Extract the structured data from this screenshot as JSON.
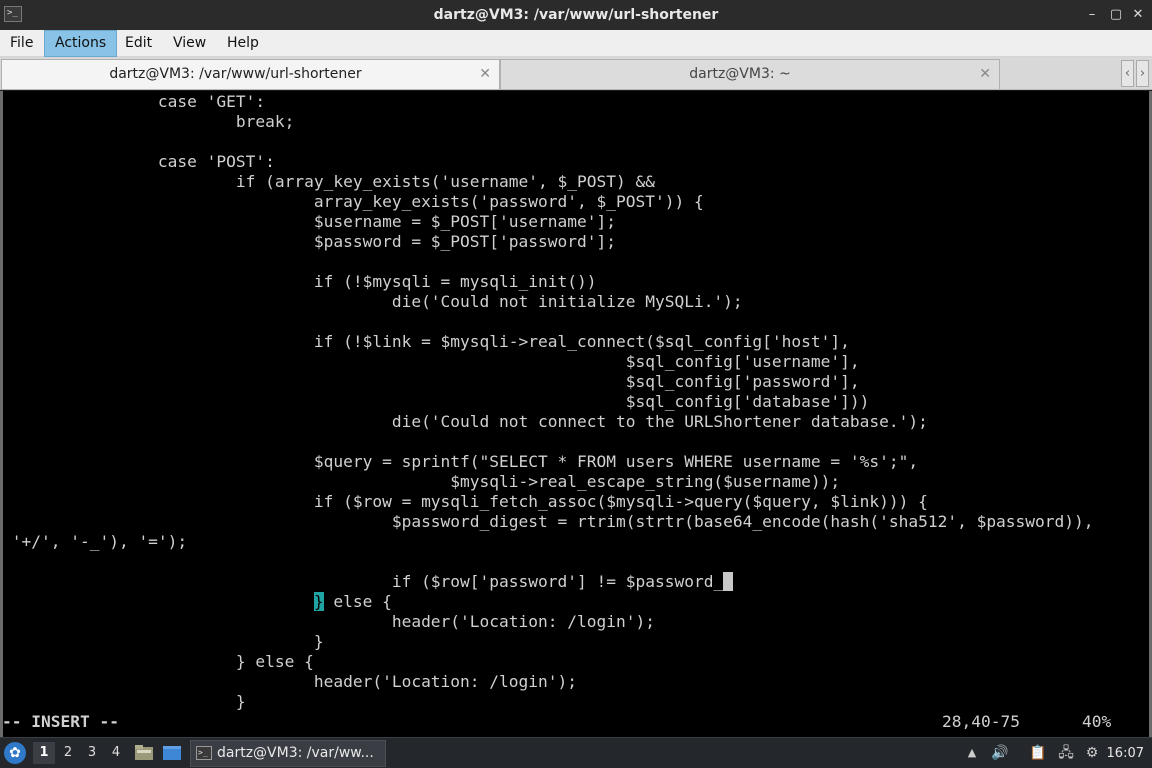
{
  "window": {
    "title": "dartz@VM3: /var/www/url-shortener",
    "app_icon_glyph": ">_",
    "minimize_glyph": "–",
    "maximize_glyph": "▢",
    "close_glyph": "✕"
  },
  "menu": {
    "items": [
      "File",
      "Actions",
      "Edit",
      "View",
      "Help"
    ],
    "active": "Actions"
  },
  "tabs": [
    {
      "label": "dartz@VM3: /var/www/url-shortener",
      "close": "✕",
      "active": true
    },
    {
      "label": "dartz@VM3: ~",
      "close": "✕",
      "active": false
    }
  ],
  "tab_scroll": {
    "left": "‹",
    "right": "›"
  },
  "terminal": {
    "lines": [
      {
        "text": "                case 'GET':"
      },
      {
        "text": "                        break;"
      },
      {
        "text": ""
      },
      {
        "text": "                case 'POST':"
      },
      {
        "text": "                        if (array_key_exists('username', $_POST) &&"
      },
      {
        "text": "                                array_key_exists('password', $_POST')) {"
      },
      {
        "text": "                                $username = $_POST['username'];"
      },
      {
        "text": "                                $password = $_POST['password'];"
      },
      {
        "text": ""
      },
      {
        "text": "                                if (!$mysqli = mysqli_init())"
      },
      {
        "text": "                                        die('Could not initialize MySQLi.');"
      },
      {
        "text": ""
      },
      {
        "text": "                                if (!$link = $mysqli->real_connect($sql_config['host'],"
      },
      {
        "text": "                                                                $sql_config['username'],"
      },
      {
        "text": "                                                                $sql_config['password'],"
      },
      {
        "text": "                                                                $sql_config['database']))"
      },
      {
        "text": "                                        die('Could not connect to the URLShortener database.');"
      },
      {
        "text": ""
      },
      {
        "text": "                                $query = sprintf(\"SELECT * FROM users WHERE username = '%s';\","
      },
      {
        "text": "                                              $mysqli->real_escape_string($username));"
      },
      {
        "text": "                                if ($row = mysqli_fetch_assoc($mysqli->query($query, $link))) {"
      },
      {
        "text": "                                        $password_digest = rtrim(strtr(base64_encode(hash('sha512', $password)),"
      },
      {
        "text": " '+/', '-_'), '=');"
      },
      {
        "text": ""
      },
      {
        "text": "                                        if ($row['password'] != $password_",
        "cursor_block": " "
      },
      {
        "pre": "                                ",
        "bracket": "}",
        "text": " else {"
      },
      {
        "text": "                                        header('Location: /login');"
      },
      {
        "text": "                                }"
      },
      {
        "text": "                        } else {"
      },
      {
        "text": "                                header('Location: /login');"
      },
      {
        "text": "                        }"
      }
    ],
    "status": {
      "mode": "-- INSERT --",
      "position": "28,40-75",
      "percent": "40%"
    }
  },
  "taskbar": {
    "start_glyph": "✿",
    "workspaces": [
      "1",
      "2",
      "3",
      "4"
    ],
    "active_workspace": "1",
    "task_label": "dartz@VM3: /var/ww...",
    "task_icon_glyph": ">_",
    "tray": {
      "up_glyph": "▲",
      "volume_glyph": "🔊",
      "clipboard_glyph": "📋",
      "network_glyph": "🖧",
      "settings_glyph": "⚙"
    },
    "clock": "16:07"
  },
  "colors": {
    "terminal_bg": "#000000",
    "terminal_fg": "#d0d0d0",
    "bracket_highlight": "#1fa3a3",
    "menu_active": "#88c2e6",
    "taskbar_bg": "#24272b"
  }
}
